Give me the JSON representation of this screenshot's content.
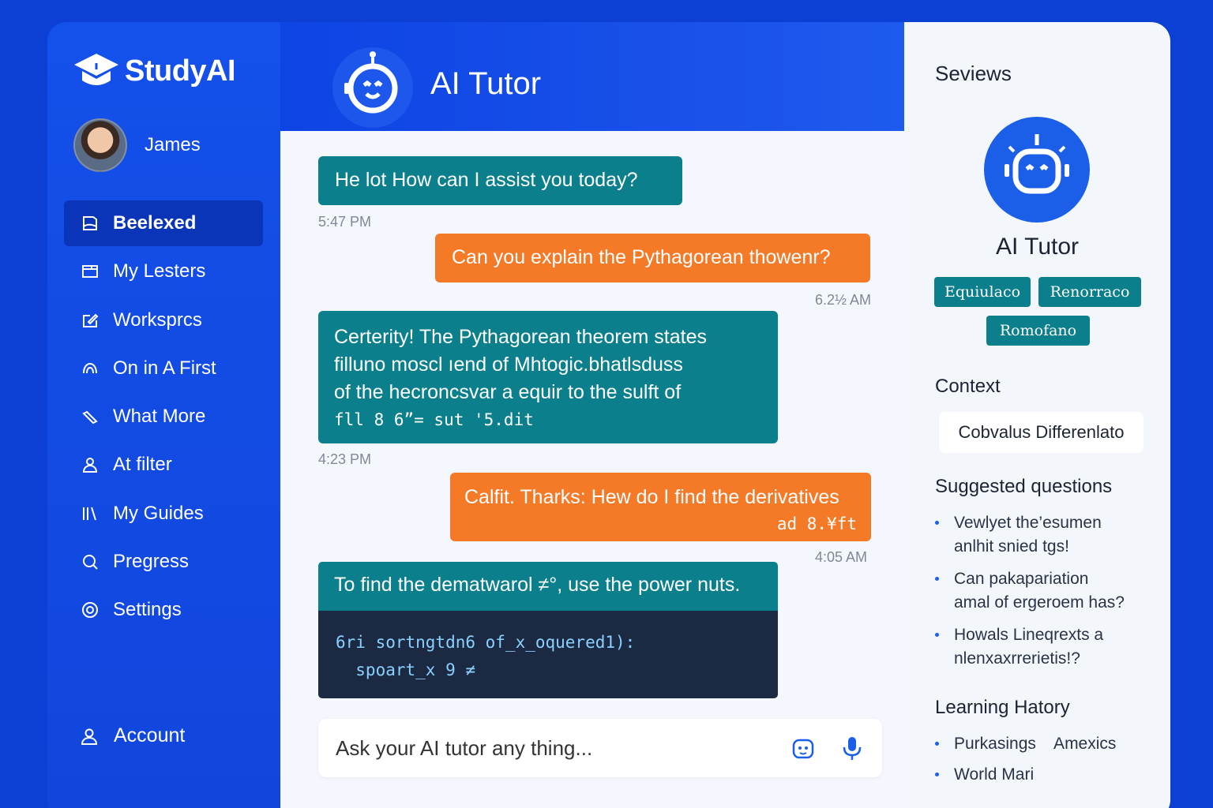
{
  "brand": {
    "name": "StudyAI"
  },
  "user": {
    "name": "James"
  },
  "nav": {
    "items": [
      {
        "label": "Beelexed",
        "icon": "book-icon",
        "active": true
      },
      {
        "label": "My Lesters",
        "icon": "image-icon"
      },
      {
        "label": "Worksprcs",
        "icon": "edit-icon"
      },
      {
        "label": "On in A First",
        "icon": "wave-icon"
      },
      {
        "label": "What More",
        "icon": "pen-icon"
      },
      {
        "label": "At filter",
        "icon": "users-icon"
      },
      {
        "label": "My Guides",
        "icon": "library-icon"
      },
      {
        "label": "Pregress",
        "icon": "search-icon"
      },
      {
        "label": "Settings",
        "icon": "gear-icon"
      }
    ],
    "account_label": "Account"
  },
  "header": {
    "title": "AI Tutor"
  },
  "chat": {
    "messages": [
      {
        "role": "ai",
        "text": "He lot How can I assist you today?",
        "time": "5:47 PM"
      },
      {
        "role": "user",
        "text": "Can you explain the Pythagorean thowenr?",
        "time": "6.2½ AM"
      },
      {
        "role": "ai",
        "lines": [
          "Certerity! The Pythagorean theorem states",
          "filluno moscl ıend of Μhtogic.bhatlsduss",
          "of the hecroncsvar a equir to the sulft of",
          "fll 8 6”=  sut '5.dit"
        ],
        "time": "4:23 PM"
      },
      {
        "role": "user",
        "lines": [
          "Calfit. Tharks: Hew do I find the derivatives",
          "ad 8.¥ft"
        ],
        "time": "4:05 AM"
      },
      {
        "role": "ai",
        "text": "To find the dematwarol ≠°, use the power nuts."
      }
    ],
    "code": [
      "6ri sortngtdn6 of_x_oquered1):",
      "  spοart_x 9 ≠"
    ],
    "input_placeholder": "Ask your AI tutor any thing...",
    "icons": [
      "robot-icon",
      "microphone-icon"
    ]
  },
  "panel": {
    "title": "Seviews",
    "tutor_name": "AI Tutor",
    "tags": [
      "Equiulaco",
      "Renorraco",
      "Romofano"
    ],
    "context_heading": "Context",
    "context_value": "Cobvalus Differenlato",
    "suggested_heading": "Suggested questions",
    "suggested": [
      [
        "Vewlyet the’esumen",
        "anlhit snied tgs!"
      ],
      [
        "Can pakapariation",
        "amal of ergeroem has?"
      ],
      [
        "Howals Lineqrexts a",
        "nlenxaxrrerietis!?"
      ]
    ],
    "history_heading": "Learning Hatory",
    "history": [
      "Purkasings    Amexics",
      "World Mari"
    ]
  },
  "colors": {
    "brand_blue": "#1449e3",
    "ai_bubble": "#0b7f8c",
    "user_bubble": "#f47a28",
    "code_bg": "#1b2a42"
  }
}
